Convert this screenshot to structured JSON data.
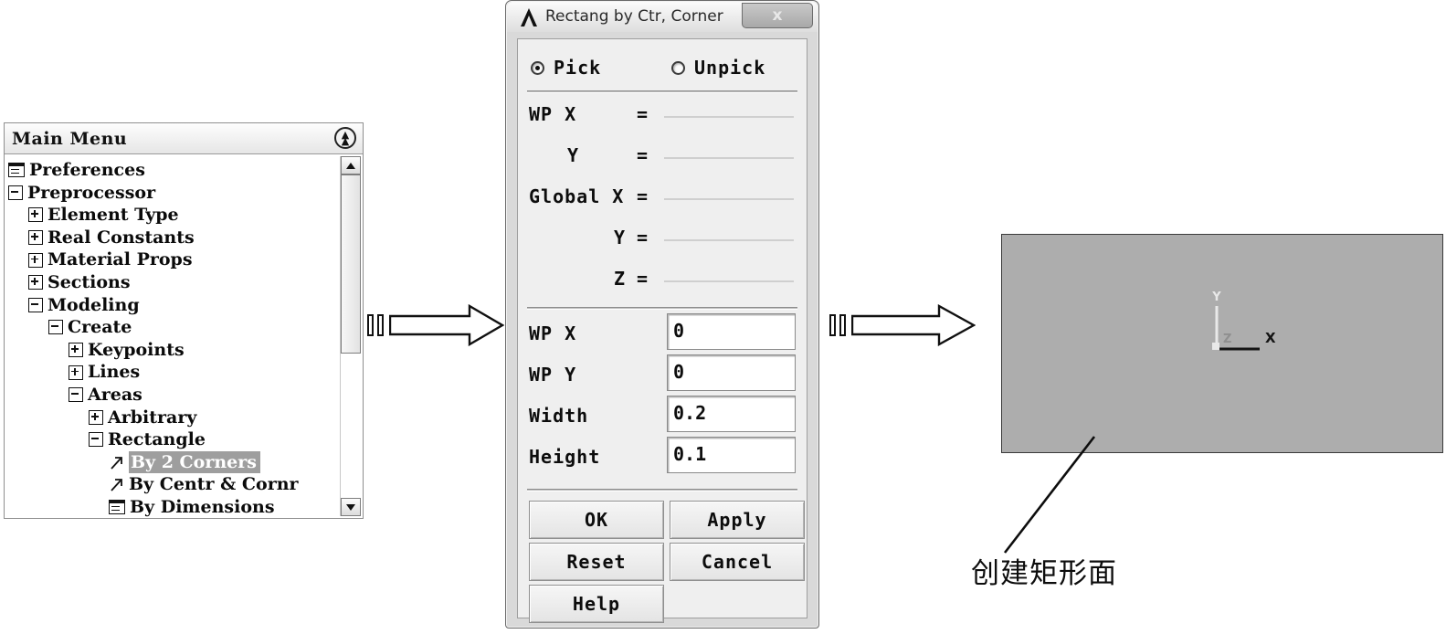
{
  "main_menu": {
    "title": "Main Menu",
    "collapse_icon": "chevron-up-double-icon",
    "tree": [
      {
        "label": "Preferences",
        "indent": 1,
        "icon": "dialog-icon",
        "state": "none",
        "selected": false
      },
      {
        "label": "Preprocessor",
        "indent": 1,
        "icon": "expander-icon",
        "state": "expanded",
        "selected": false
      },
      {
        "label": "Element Type",
        "indent": 2,
        "icon": "expander-icon",
        "state": "collapsed",
        "selected": false
      },
      {
        "label": "Real Constants",
        "indent": 2,
        "icon": "expander-icon",
        "state": "collapsed",
        "selected": false
      },
      {
        "label": "Material Props",
        "indent": 2,
        "icon": "expander-icon",
        "state": "collapsed",
        "selected": false
      },
      {
        "label": "Sections",
        "indent": 2,
        "icon": "expander-icon",
        "state": "collapsed",
        "selected": false
      },
      {
        "label": "Modeling",
        "indent": 2,
        "icon": "expander-icon",
        "state": "expanded",
        "selected": false
      },
      {
        "label": "Create",
        "indent": 3,
        "icon": "expander-icon",
        "state": "expanded",
        "selected": false
      },
      {
        "label": "Keypoints",
        "indent": 4,
        "icon": "expander-icon",
        "state": "collapsed",
        "selected": false
      },
      {
        "label": "Lines",
        "indent": 4,
        "icon": "expander-icon",
        "state": "collapsed",
        "selected": false
      },
      {
        "label": "Areas",
        "indent": 4,
        "icon": "expander-icon",
        "state": "expanded",
        "selected": false
      },
      {
        "label": "Arbitrary",
        "indent": 5,
        "icon": "expander-icon",
        "state": "collapsed",
        "selected": false
      },
      {
        "label": "Rectangle",
        "indent": 5,
        "icon": "expander-icon",
        "state": "expanded",
        "selected": false
      },
      {
        "label": "By 2 Corners",
        "indent": 6,
        "icon": "picker-arrow-icon",
        "state": "none",
        "selected": true
      },
      {
        "label": "By Centr & Cornr",
        "indent": 6,
        "icon": "picker-arrow-icon",
        "state": "none",
        "selected": false
      },
      {
        "label": "By Dimensions",
        "indent": 6,
        "icon": "dialog-icon",
        "state": "none",
        "selected": false
      }
    ],
    "scrollbar": {
      "up_arrow": "triangle-up-icon",
      "down_arrow": "triangle-down-icon"
    }
  },
  "dialog": {
    "title": "Rectang by Ctr, Corner",
    "logo_icon": "ansys-lambda-logo",
    "close_label": "x",
    "radios": [
      {
        "label": "Pick",
        "selected": true
      },
      {
        "label": "Unpick",
        "selected": false
      }
    ],
    "coords": [
      {
        "name": "WP X",
        "eq": "=",
        "value": ""
      },
      {
        "name": "Y",
        "eq": "=",
        "value": ""
      },
      {
        "name": "Global X",
        "eq": "=",
        "value": ""
      },
      {
        "name": "Y",
        "eq": "=",
        "value": ""
      },
      {
        "name": "Z",
        "eq": "=",
        "value": ""
      }
    ],
    "fields": [
      {
        "label": "WP X",
        "value": "0"
      },
      {
        "label": "WP Y",
        "value": "0"
      },
      {
        "label": "Width",
        "value": "0.2"
      },
      {
        "label": "Height",
        "value": "0.1"
      }
    ],
    "buttons": [
      {
        "label": "OK"
      },
      {
        "label": "Apply"
      },
      {
        "label": "Reset"
      },
      {
        "label": "Cancel"
      },
      {
        "label": "Help"
      }
    ]
  },
  "graphics": {
    "triad": {
      "y_label": "Y",
      "z_label": "Z",
      "x_label": "X"
    },
    "caption": "创建矩形面",
    "rect_fill": "#adadad",
    "rect_border": "#3a3a3a"
  },
  "flow": {
    "arrow1": "right-arrow-icon",
    "arrow2": "right-arrow-icon"
  }
}
